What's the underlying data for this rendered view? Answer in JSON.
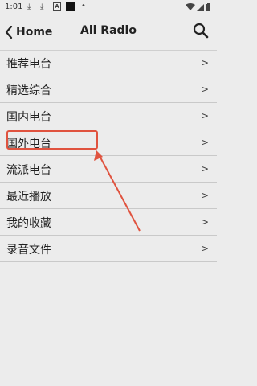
{
  "status_bar": {
    "time": "1:01",
    "icons": [
      "download-icon",
      "download-icon",
      "font-icon",
      "black-square",
      "dot"
    ]
  },
  "header": {
    "back_label": "Home",
    "title": "All Radio"
  },
  "list": {
    "items": [
      {
        "label": "推荐电台",
        "chevron": ">"
      },
      {
        "label": "精选综合",
        "chevron": ">"
      },
      {
        "label": "国内电台",
        "chevron": ">"
      },
      {
        "label": "国外电台",
        "chevron": ">"
      },
      {
        "label": "流派电台",
        "chevron": ">"
      },
      {
        "label": "最近播放",
        "chevron": ">"
      },
      {
        "label": "我的收藏",
        "chevron": ">"
      },
      {
        "label": "录音文件",
        "chevron": ">"
      }
    ]
  },
  "colors": {
    "background": "#ececec",
    "annotation": "#e0533f"
  }
}
